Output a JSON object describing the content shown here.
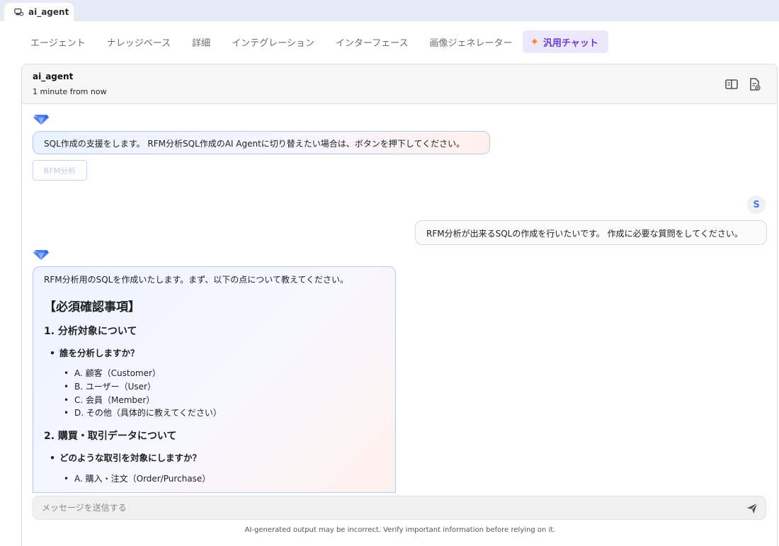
{
  "window_tab": {
    "title": "ai_agent",
    "icon": "agent-icon"
  },
  "nav": {
    "items": [
      {
        "label": "エージェント"
      },
      {
        "label": "ナレッジベース"
      },
      {
        "label": "詳細"
      },
      {
        "label": "インテグレーション"
      },
      {
        "label": "インターフェース"
      },
      {
        "label": "画像ジェネレーター"
      },
      {
        "label": "汎用チャット",
        "active": true,
        "icon": "sparkle-icon"
      }
    ]
  },
  "chat_header": {
    "title": "ai_agent",
    "subtitle": "1 minute from now",
    "icons": [
      "panel-toggle-icon",
      "document-add-icon"
    ]
  },
  "messages": {
    "ai_1": {
      "text": "SQL作成の支援をします。 RFM分析SQL作成のAI Agentに切り替えたい場合は、ボタンを押下してください。",
      "button": "RFM分析"
    },
    "user_1": {
      "avatar": "S",
      "text": "RFM分析が出来るSQLの作成を行いたいです。 作成に必要な質問をしてください。"
    },
    "ai_2": {
      "intro": "RFM分析用のSQLを作成いたします。まず、以下の点について教えてください。",
      "heading": "【必須確認事項】",
      "section_1": {
        "title": "1. 分析対象について",
        "question": "誰を分析しますか？",
        "options": [
          "A. 顧客（Customer）",
          "B. ユーザー（User）",
          "C. 会員（Member）",
          "D. その他（具体的に教えてください）"
        ]
      },
      "section_2": {
        "title": "2. 購買・取引データについて",
        "question": "どのような取引を対象にしますか？",
        "options": [
          "A. 購入・注文（Order/Purchase）"
        ]
      }
    }
  },
  "composer": {
    "placeholder": "メッセージを送信する",
    "value": ""
  },
  "disclaimer": "AI-generated output may be incorrect. Verify important information before relying on it.",
  "colors": {
    "accent": "#6a3fc4",
    "active_tab_bg": "#ede7fb",
    "gem": "#4a7df0",
    "user_avatar": "#4a79d8"
  }
}
